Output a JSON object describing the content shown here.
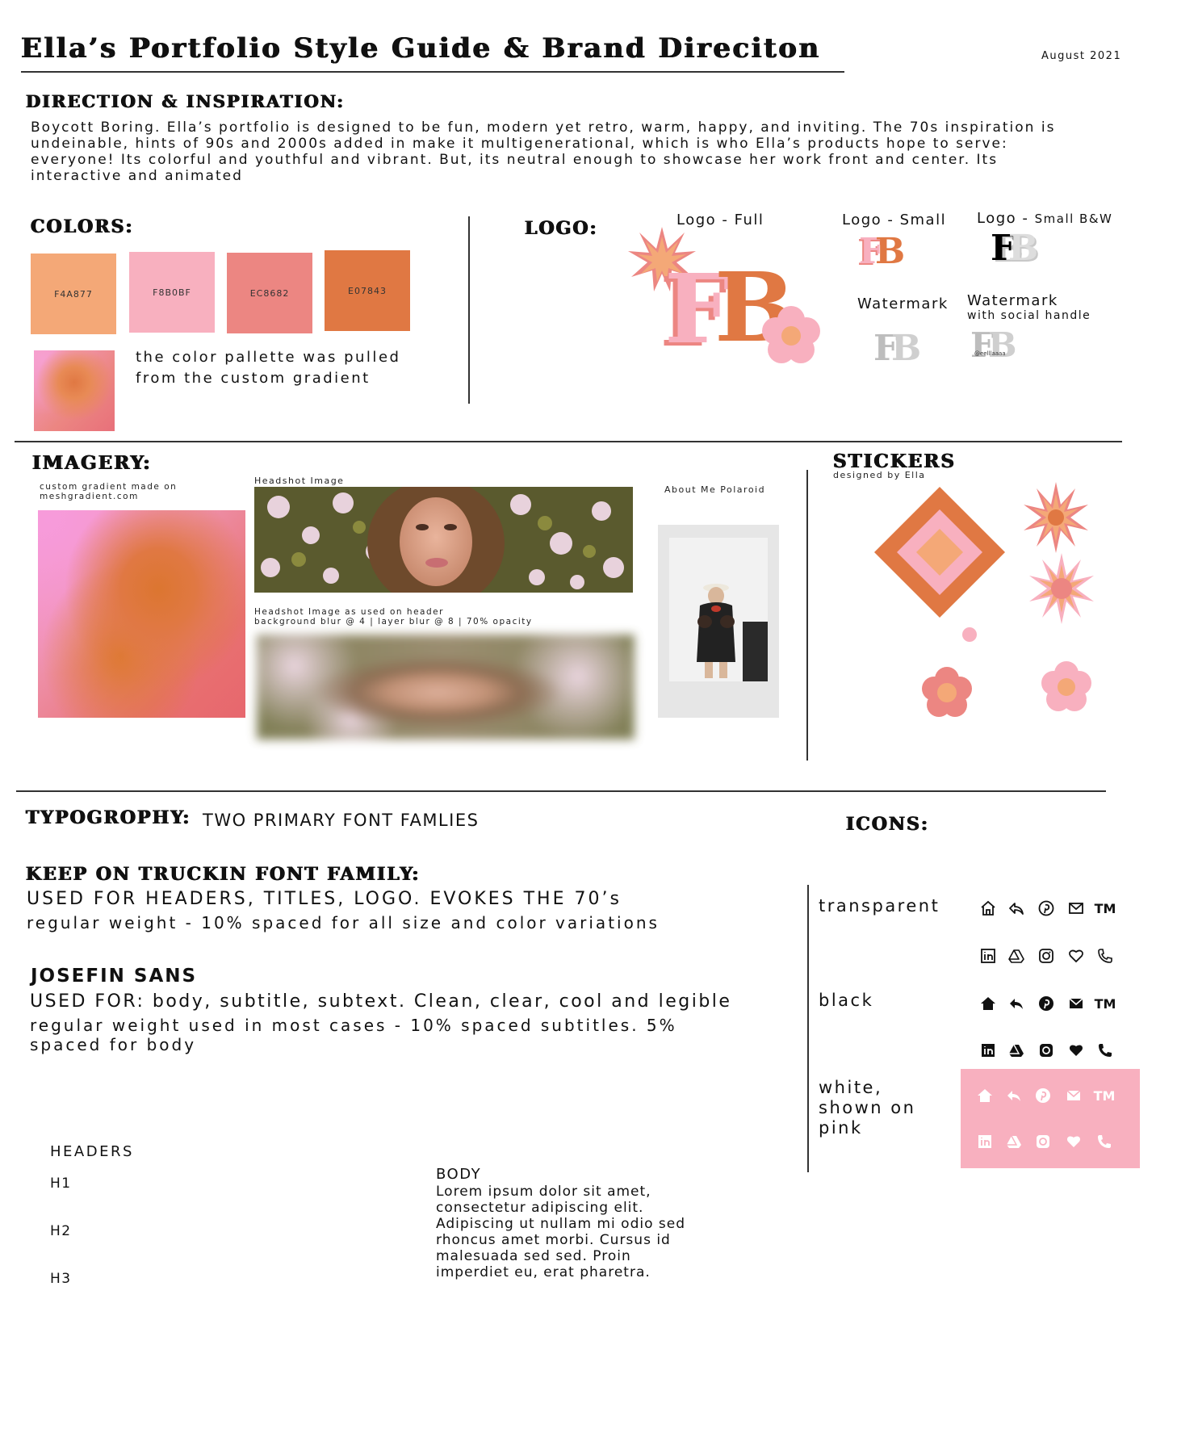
{
  "header": {
    "title": "Ella’s Portfolio Style Guide & Brand Direciton",
    "date": "August 2021"
  },
  "direction": {
    "title": "DIRECTION & INSPIRATION:",
    "text": "Boycott Boring. Ella’s portfolio is designed to be fun, modern yet retro, warm, happy, and inviting. The 70s inspiration is undeinable, hints of 90s and 2000s added in make it multigenerational, which is who Ella’s products hope to serve: everyone! Its colorful and youthful and vibrant. But, its neutral enough to showcase her work front and center. Its interactive and animated"
  },
  "colors": {
    "title": "COLORS:",
    "swatches": [
      {
        "hex": "#F4A877",
        "label": "F4A877"
      },
      {
        "hex": "#F8B0BF",
        "label": "F8B0BF"
      },
      {
        "hex": "#EC8682",
        "label": "EC8682"
      },
      {
        "hex": "#E07843",
        "label": "E07843"
      }
    ],
    "note": "the color pallette was pulled from the custom gradient"
  },
  "logo": {
    "title": "LOGO:",
    "full_label": "Logo - Full",
    "small_label": "Logo - Small",
    "small_bw_label": "Logo -",
    "small_bw_suffix": "Small B&W",
    "watermark_label": "Watermark",
    "watermark_social_label": "Watermark",
    "watermark_social_sub": "with social handle",
    "handle": "@eelllaaaa",
    "mark": "FB"
  },
  "imagery": {
    "title": "IMAGERY:",
    "gradient_caption": "custom gradient made on meshgradient.com",
    "headshot_label": "Headshot Image",
    "headshot_header_label": "Headshot Image as used on header",
    "headshot_header_sub": "background blur @ 4 | layer blur @ 8 | 70% opacity",
    "polaroid_label": "About Me Polaroid"
  },
  "stickers": {
    "title": "STICKERS",
    "subtitle": "designed by Ella"
  },
  "typography": {
    "title": "TYPOGROPHY:",
    "subtitle": "TWO PRIMARY FONT FAMLIES",
    "font1_name": "KEEP ON TRUCKIN FONT FAMILY:",
    "font1_use": "USED FOR HEADERS, TITLES, LOGO. EVOKES THE 70’s",
    "font1_note": "regular weight - 10% spaced for all size and color variations",
    "font2_name": "JOSEFIN SANS",
    "font2_use": "USED FOR: body, subtitle, subtext. Clean, clear, cool and legible",
    "font2_note": "regular weight used in most cases - 10% spaced subtitles. 5% spaced for body",
    "headers_label": "HEADERS",
    "h1": "H1",
    "h2": "H2",
    "h3": "H3",
    "body_label": "BODY",
    "body_text": "Lorem ipsum dolor sit amet, consectetur adipiscing elit. Adipiscing ut nullam mi odio sed rhoncus amet morbi. Cursus id malesuada sed sed. Proin imperdiet eu, erat pharetra."
  },
  "icons": {
    "title": "ICONS:",
    "row_labels": {
      "transparent": "transparent",
      "black": "black",
      "white": "white, shown on pink"
    },
    "tm": "TM",
    "set": [
      "home-icon",
      "reply-icon",
      "pinterest-icon",
      "mail-icon",
      "trademark-icon",
      "linkedin-icon",
      "drive-icon",
      "instagram-icon",
      "heart-icon",
      "phone-icon"
    ],
    "pink_bg": "#F8B0BF"
  },
  "palette": {
    "peach": "#F4A877",
    "pink": "#F8B0BF",
    "coral": "#EC8682",
    "orange": "#E07843",
    "gray": "#C8C8C8"
  }
}
